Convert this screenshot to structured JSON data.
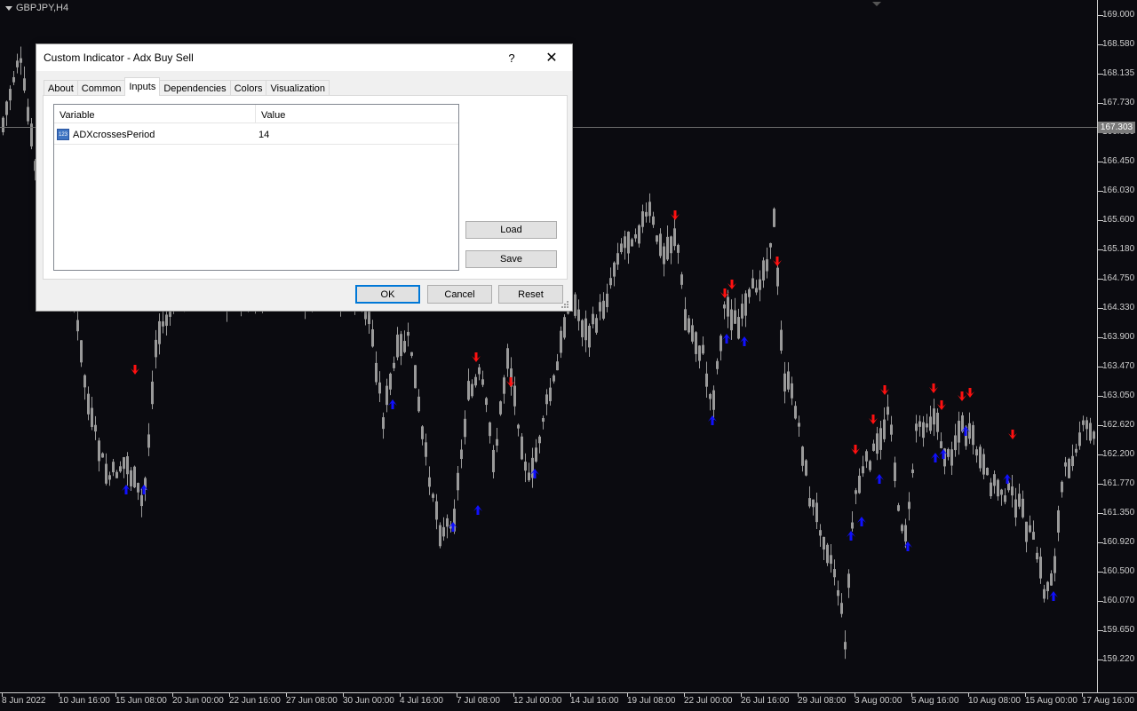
{
  "chart": {
    "symbol": "GBPJPY,H4",
    "current_price": "167.303",
    "price_labels": [
      "169.000",
      "168.580",
      "168.135",
      "167.730",
      "166.880",
      "166.450",
      "166.030",
      "165.600",
      "165.180",
      "164.750",
      "164.330",
      "163.900",
      "163.470",
      "163.050",
      "162.620",
      "162.200",
      "161.770",
      "161.350",
      "160.920",
      "160.500",
      "160.070",
      "159.650",
      "159.220"
    ],
    "time_labels": [
      "8 Jun 2022",
      "10 Jun 16:00",
      "15 Jun 08:00",
      "20 Jun 00:00",
      "22 Jun 16:00",
      "27 Jun 08:00",
      "30 Jun 00:00",
      "4 Jul 16:00",
      "7 Jul 08:00",
      "12 Jul 00:00",
      "14 Jul 16:00",
      "19 Jul 08:00",
      "22 Jul 00:00",
      "26 Jul 16:00",
      "29 Jul 08:00",
      "3 Aug 00:00",
      "5 Aug 16:00",
      "10 Aug 08:00",
      "15 Aug 00:00",
      "17 Aug 16:00"
    ],
    "colors": {
      "background": "#0b0b10",
      "candle": "#9a9a9a",
      "sell_arrow": "#ff1010",
      "buy_arrow": "#1010ff",
      "axis": "#cfcfcf"
    }
  },
  "dialog": {
    "title": "Custom Indicator - Adx Buy Sell",
    "help_label": "?",
    "close_label": "✕",
    "tabs": [
      {
        "label": "About",
        "active": false
      },
      {
        "label": "Common",
        "active": false
      },
      {
        "label": "Inputs",
        "active": true
      },
      {
        "label": "Dependencies",
        "active": false
      },
      {
        "label": "Colors",
        "active": false
      },
      {
        "label": "Visualization",
        "active": false
      }
    ],
    "table": {
      "headers": {
        "variable": "Variable",
        "value": "Value"
      },
      "rows": [
        {
          "icon": "numeric-123-icon",
          "icon_text": "123",
          "variable": "ADXcrossesPeriod",
          "value": "14"
        }
      ]
    },
    "buttons": {
      "load": "Load",
      "save": "Save",
      "ok": "OK",
      "cancel": "Cancel",
      "reset": "Reset"
    }
  }
}
